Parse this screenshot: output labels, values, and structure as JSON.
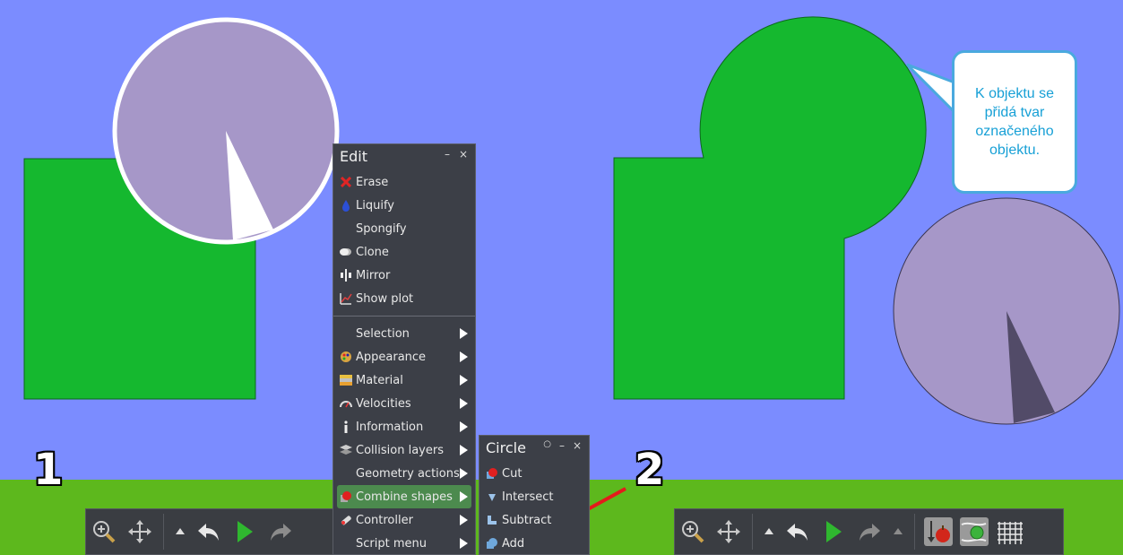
{
  "colors": {
    "sky": "#7b8cff",
    "ground": "#5db81d",
    "green_shape": "#15b82f",
    "purple_circle": "#a697c8",
    "menu_bg": "#3c3f47",
    "menu_highlight": "#4c8a4e",
    "callout_text": "#17a0d6",
    "callout_border": "#4aa9de",
    "arrow": "#e41b1b"
  },
  "annotations": {
    "step1": "1",
    "step2": "2",
    "callout": "K objektu se\npřidá tvar\noznačeného\nobjektu."
  },
  "edit_menu": {
    "title": "Edit",
    "controls": [
      "–",
      "×"
    ],
    "items": [
      {
        "label": "Erase",
        "icon": "red-x-icon"
      },
      {
        "label": "Liquify",
        "icon": "water-drop-icon"
      },
      {
        "label": "Spongify",
        "icon": ""
      },
      {
        "label": "Clone",
        "icon": "clone-icon"
      },
      {
        "label": "Mirror",
        "icon": "mirror-icon"
      },
      {
        "label": "Show plot",
        "icon": "plot-icon"
      }
    ],
    "submenus": [
      {
        "label": "Selection",
        "icon": ""
      },
      {
        "label": "Appearance",
        "icon": "palette-icon"
      },
      {
        "label": "Material",
        "icon": "material-icon"
      },
      {
        "label": "Velocities",
        "icon": "speedometer-icon"
      },
      {
        "label": "Information",
        "icon": "info-icon"
      },
      {
        "label": "Collision layers",
        "icon": "layers-icon"
      },
      {
        "label": "Geometry actions",
        "icon": ""
      },
      {
        "label": "Combine shapes",
        "icon": "combine-icon",
        "highlighted": true
      },
      {
        "label": "Controller",
        "icon": "controller-icon"
      },
      {
        "label": "Script menu",
        "icon": ""
      }
    ]
  },
  "circle_menu": {
    "title": "Circle",
    "controls": [
      "○",
      "–",
      "×"
    ],
    "items": [
      {
        "label": "Cut",
        "icon": "cut-icon"
      },
      {
        "label": "Intersect",
        "icon": "intersect-icon"
      },
      {
        "label": "Subtract",
        "icon": "subtract-icon"
      },
      {
        "label": "Add",
        "icon": "add-shape-icon"
      }
    ]
  },
  "toolbar_left": [
    "zoom-icon",
    "move-icon",
    "up-arrow-icon",
    "undo-icon",
    "play-icon",
    "redo-icon"
  ],
  "toolbar_right": [
    "zoom-icon",
    "move-icon",
    "up-arrow-icon",
    "undo-icon",
    "play-icon",
    "redo-icon",
    "up-arrow-icon",
    "gravity-icon",
    "air-friction-icon",
    "grid-icon"
  ]
}
